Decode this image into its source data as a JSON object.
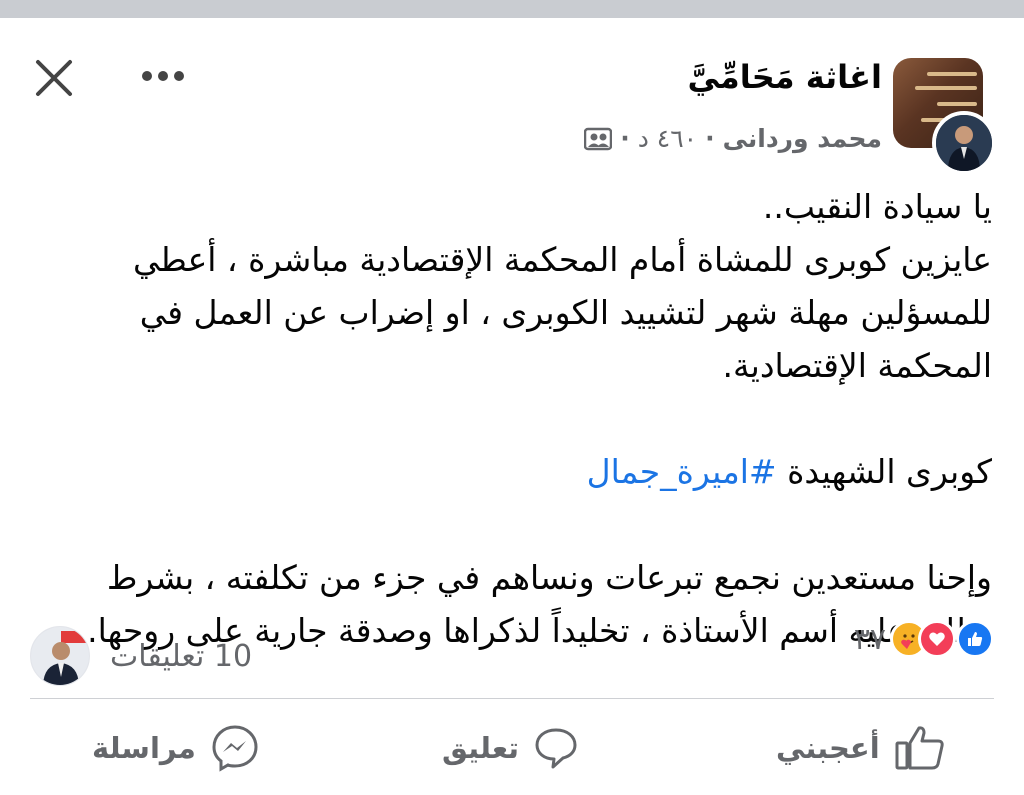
{
  "header": {
    "group_name": "اغاثة مَحَامِّيَّ",
    "author": "محمد وردانى",
    "time": "٤٦٠ د",
    "separator": "·"
  },
  "post": {
    "lines": [
      "يا سيادة النقيب..",
      "عايزين كوبرى للمشاة أمام المحكمة الإقتصادية مباشرة ، أعطي",
      "للمسؤلين مهلة شهر لتشييد الكوبرى ، او إضراب عن العمل في",
      "المحكمة الإقتصادية."
    ],
    "hashtag_prefix": "كوبرى الشهيدة ",
    "hashtag": "#اميرة_جمال",
    "closing_lines": [
      "وإحنا مستعدين نجمع تبرعات ونساهم في جزء من تكلفته ، بشرط",
      "يطلق عليه أسم الأستاذة ، تخليداً لذكراها وصدقة جارية على روحها."
    ]
  },
  "stats": {
    "reaction_count": "٣٧",
    "comments_label": "10 تعليقات"
  },
  "actions": {
    "like": "أعجبني",
    "comment": "تعليق",
    "message": "مراسلة"
  },
  "colors": {
    "link": "#1b74e4",
    "secondary_text": "#65676b",
    "like_blue": "#1877f2",
    "love_red": "#f33e58",
    "care_yellow": "#f7b125"
  }
}
